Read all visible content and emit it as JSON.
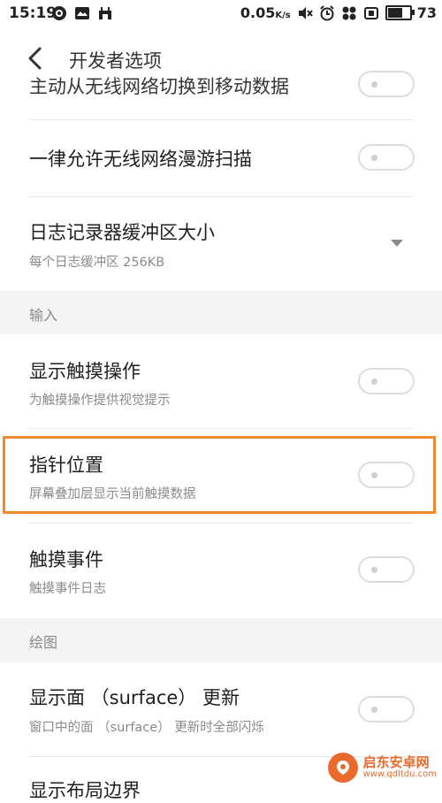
{
  "status_bar": {
    "time": "15:19",
    "network_speed": "0.05",
    "network_speed_unit": "K/s",
    "battery_level": "73",
    "icons": [
      "browser-icon",
      "message-icon",
      "robot-icon",
      "mute-icon",
      "alarm-icon",
      "app-icon",
      "sim-icon",
      "battery-icon"
    ]
  },
  "app_bar": {
    "title": "开发者选项"
  },
  "partial_top_label": "主动从无线网络切换到移动数据",
  "rows_group1": [
    {
      "label": "一律允许无线网络漫游扫描",
      "sub": "",
      "control": "toggle",
      "state": "off"
    },
    {
      "label": "日志记录器缓冲区大小",
      "sub": "每个日志缓冲区 256KB",
      "control": "dropdown"
    }
  ],
  "section_input": {
    "title": "输入",
    "rows": [
      {
        "label": "显示触摸操作",
        "sub": "为触摸操作提供视觉提示",
        "control": "toggle",
        "state": "off"
      },
      {
        "label": "指针位置",
        "sub": "屏幕叠加层显示当前触摸数据",
        "control": "toggle",
        "state": "off",
        "highlighted": true
      },
      {
        "label": "触摸事件",
        "sub": "触摸事件日志",
        "control": "toggle",
        "state": "off"
      }
    ]
  },
  "section_drawing": {
    "title": "绘图",
    "rows": [
      {
        "label": "显示面 （surface） 更新",
        "sub": "窗口中的面 （surface） 更新时全部闪烁",
        "control": "toggle",
        "state": "off"
      }
    ],
    "partial_bottom_label": "显示布局边界"
  },
  "watermark": {
    "name": "启东安卓网",
    "url": "www.qdltdu.com"
  },
  "colors": {
    "highlight": "#ef8a2f",
    "section_bg": "#f4f4f4",
    "toggle_border": "#dcdcdc"
  }
}
